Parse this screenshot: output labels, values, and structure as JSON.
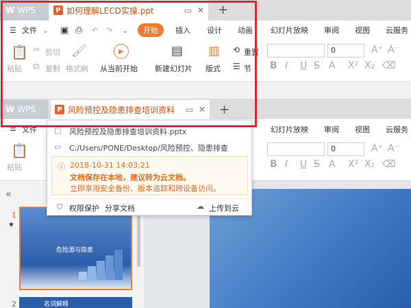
{
  "window1": {
    "tabs": {
      "wps_label": "WPS",
      "doc_title": "如何理解LECD实操.ppt",
      "add_tab": "+"
    },
    "menu": {
      "file": "文件",
      "items": [
        "开始",
        "插入",
        "设计",
        "动画",
        "幻灯片放映",
        "审阅",
        "视图",
        "云服务"
      ]
    },
    "ribbon": {
      "paste": "粘贴",
      "cut": "剪切",
      "copy": "复制",
      "format_painter": "格式刷",
      "play_from_current": "从当前开始",
      "new_slide": "新建幻灯片",
      "layout": "版式",
      "reset": "重置",
      "section": "节",
      "font_size": "0",
      "format_buttons": [
        "B",
        "I",
        "U",
        "S",
        "A",
        "X²",
        "X₂"
      ]
    }
  },
  "window2": {
    "tabs": {
      "wps_label": "WPS",
      "doc_title": "风险预控及隐患排查培训资料",
      "add_tab": "+"
    },
    "menu": {
      "file": "文件",
      "items": [
        "幻灯片放映",
        "审阅",
        "视图",
        "云服务"
      ]
    },
    "ribbon": {
      "paste": "粘贴",
      "font_size": "0"
    },
    "popup": {
      "filename": "风险预控及隐患排查培训资料.pptx",
      "path": "C:/Users/PONE/Desktop/风险预控、隐患排查",
      "date": "2018-10-31 14:03:21",
      "warn_main": "文档保存在本地，建议转为云文档。",
      "warn_sub": "立即享用安全备份、版本追踪和跨设备访问。",
      "permission": "权限保护",
      "share": "分享文档",
      "upload": "上传到云"
    },
    "sidebar": {
      "collapse": "«",
      "slide1_num": "1",
      "slide1_star": "★",
      "slide1_title": "危险源与隐患",
      "slide2_num": "2",
      "slide2_title": "名词解释"
    }
  },
  "colors": {
    "accent": "#f07a32",
    "highlight": "#e2262d",
    "warn": "#e06a1a"
  }
}
